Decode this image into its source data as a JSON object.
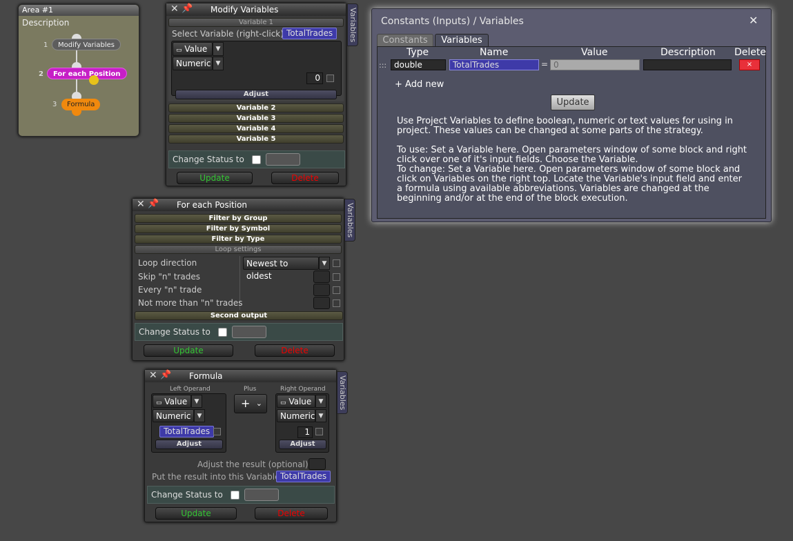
{
  "area": {
    "title": "Area #1",
    "description": "Description",
    "nodes": [
      {
        "num": "1",
        "label": "Modify Variables"
      },
      {
        "num": "2",
        "label": "For each Position"
      },
      {
        "num": "3",
        "label": "Formula"
      }
    ]
  },
  "modify_variables": {
    "title": "Modify Variables",
    "side_tab": "Variables",
    "variable1_label": "Variable 1",
    "select_label": "Select Variable (right-click)",
    "selected_variable": "TotalTrades",
    "source_type": "Value",
    "value_type": "Numeric",
    "value": "0",
    "adjust_label": "Adjust",
    "variables": [
      "Variable 2",
      "Variable 3",
      "Variable 4",
      "Variable 5"
    ],
    "change_status_label": "Change Status to",
    "update_label": "Update",
    "delete_label": "Delete"
  },
  "for_each_position": {
    "title": "For each Position",
    "side_tab": "Variables",
    "filters": [
      "Filter by Group",
      "Filter by Symbol",
      "Filter by Type"
    ],
    "loop_settings_label": "Loop settings",
    "loop_direction_label": "Loop direction",
    "loop_direction_value": "Newest to oldest",
    "skip_label": "Skip \"n\" trades",
    "every_label": "Every \"n\" trade",
    "not_more_label": "Not more than \"n\" trades",
    "second_output_label": "Second output",
    "change_status_label": "Change Status to",
    "update_label": "Update",
    "delete_label": "Delete"
  },
  "formula": {
    "title": "Formula",
    "side_tab": "Variables",
    "left_operand_label": "Left Operand",
    "operator_label": "Plus",
    "operator_symbol": "+",
    "right_operand_label": "Right Operand",
    "left_source": "Value",
    "left_type": "Numeric",
    "left_value": "TotalTrades",
    "right_source": "Value",
    "right_type": "Numeric",
    "right_value": "1",
    "adjust_label": "Adjust",
    "adjust_result_label": "Adjust the result (optional):",
    "put_result_label": "Put the result into this Variable:",
    "result_variable": "TotalTrades",
    "change_status_label": "Change Status to",
    "update_label": "Update",
    "delete_label": "Delete"
  },
  "constants": {
    "title": "Constants (Inputs) / Variables",
    "tabs": [
      "Constants",
      "Variables"
    ],
    "active_tab": "Variables",
    "columns": [
      "Type",
      "Name",
      "Value",
      "Description",
      "Delete"
    ],
    "row": {
      "handle": ":::",
      "type": "double",
      "name": "TotalTrades",
      "equals": "=",
      "value": "0",
      "description": "",
      "delete_symbol": "×"
    },
    "add_new_label": "+ Add new",
    "update_label": "Update",
    "help_p1": "Use Project Variables to define boolean, numeric or text values for using in project. These values can be changed at some parts of the strategy.",
    "help_p2": "To use: Set a Variable here. Open parameters window of some block and right click over one of it's input fields. Choose the Variable.",
    "help_p3": "To change: Set a Variable here. Open parameters window of some block and click on Variables on the right top. Locate the Variable's input field and enter a formula using available abbreviations. Variables are changed at the beginning and/or at the end of the block execution."
  },
  "colors": {
    "background": "#474747",
    "node_gray": "#5d5d5d",
    "node_magenta": "#c61fc6",
    "node_orange": "#f0890e",
    "variable_tag": "#3e3aa8",
    "update_green": "#34c534",
    "delete_red": "#e00000"
  }
}
